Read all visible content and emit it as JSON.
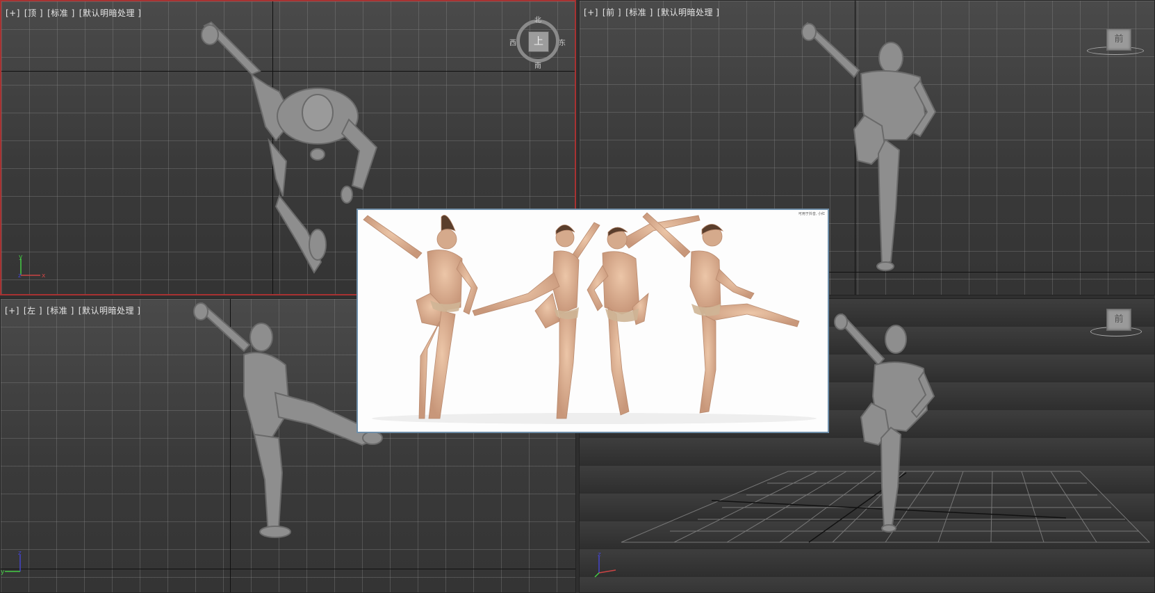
{
  "viewports": {
    "top": {
      "label": [
        "[+]",
        "[顶 ]",
        "[标准 ]",
        "[默认明暗处理 ]"
      ],
      "cube_face": "上",
      "compass": {
        "north": "北",
        "south": "南",
        "east": "东",
        "west": "西"
      }
    },
    "front": {
      "label": [
        "[+]",
        "[前 ]",
        "[标准 ]",
        "[默认明暗处理 ]"
      ],
      "cube_face": "前"
    },
    "left": {
      "label": [
        "[+]",
        "[左 ]",
        "[标准 ]",
        "[默认明暗处理 ]"
      ]
    },
    "perspective": {
      "cube_face": "前"
    }
  },
  "reference_image": {
    "corner_text": "可用于抖音, 小红"
  },
  "colors": {
    "active_border": "#a83232",
    "skin": "#e2b79a",
    "mannequin": "#8c8c8c"
  }
}
